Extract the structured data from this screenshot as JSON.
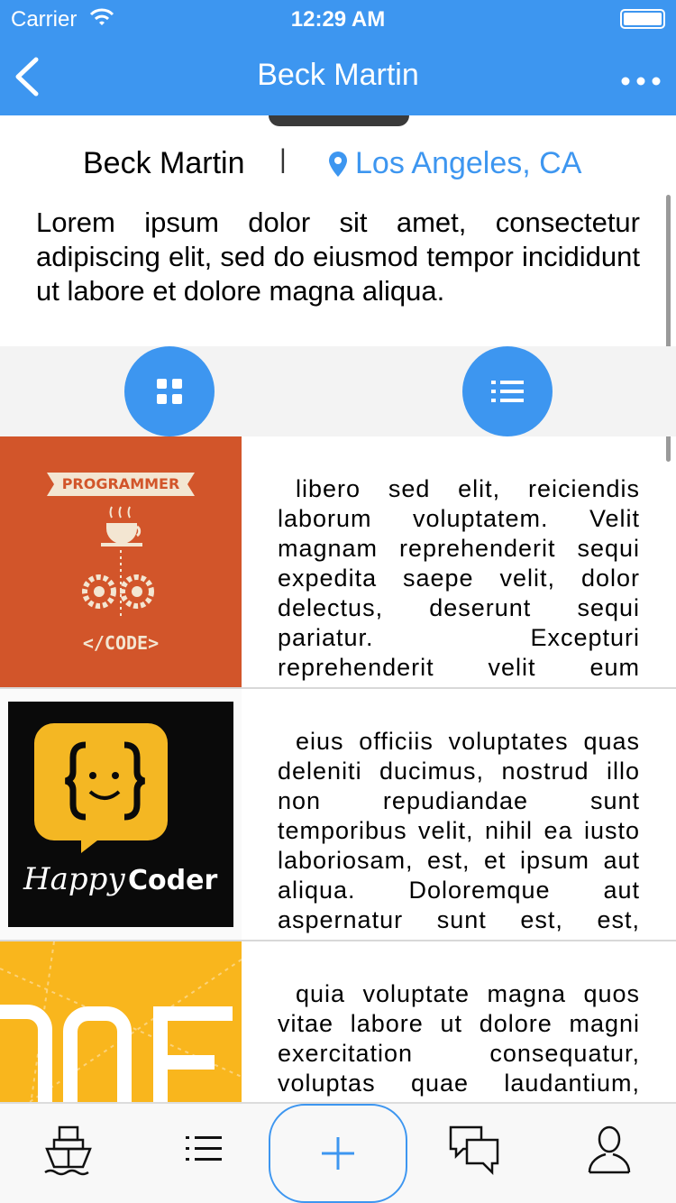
{
  "status": {
    "carrier": "Carrier",
    "time": "12:29 AM"
  },
  "nav": {
    "title": "Beck Martin",
    "back_icon": "chevron-left-icon",
    "more_icon": "more-horizontal-icon"
  },
  "profile": {
    "name": "Beck Martin",
    "separator": "|",
    "location": "Los Angeles, CA",
    "bio": "Lorem ipsum dolor sit amet, consectetur adipiscing elit, sed do eiusmod tempor incididunt ut labore et dolore magna aliqua."
  },
  "view_toggle": {
    "grid_icon": "grid-icon",
    "list_icon": "list-icon"
  },
  "feed": [
    {
      "image_labels": [
        "PROGRAMMER",
        "</CODE>"
      ],
      "text": "libero sed elit, reiciendis laborum voluptatem. Velit magnam reprehenderit sequi expedita saepe velit, dolor delectus, deserunt sequi pariatur. Excepturi reprehenderit velit eum"
    },
    {
      "image_labels": [
        "Happy",
        "Coder"
      ],
      "text": "eius officiis voluptates quas deleniti ducimus, nostrud illo non repudiandae sunt temporibus velit, nihil ea iusto laboriosam, est, et ipsum aut aliqua. Doloremque aut aspernatur sunt est, est,"
    },
    {
      "image_labels": [],
      "text": "quia voluptate magna quos vitae labore ut dolore magni exercitation consequatur, voluptas quae laudantium,"
    }
  ],
  "tabs": [
    "ship-icon",
    "list-icon",
    "plus-icon",
    "chat-icon",
    "user-icon"
  ],
  "colors": {
    "accent": "#3d96f0",
    "thumb1": "#d2552a",
    "thumb3": "#f9b61d"
  }
}
